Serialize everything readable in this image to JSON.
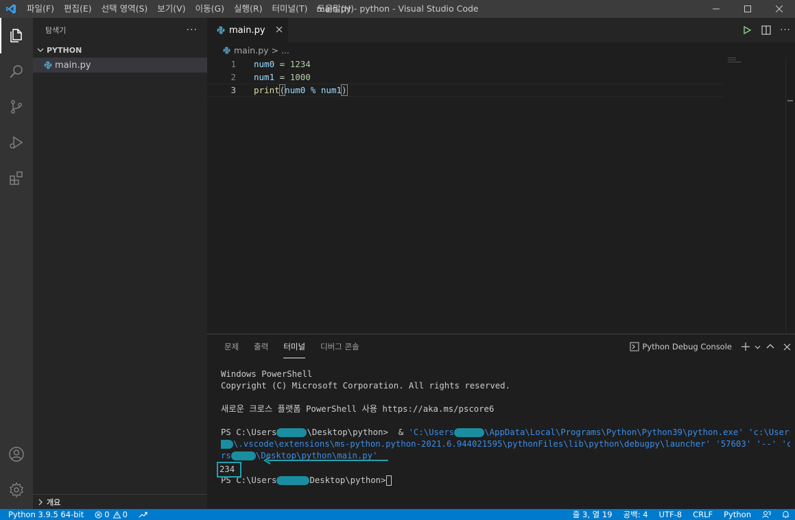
{
  "app": {
    "window_title": "main.py - python - Visual Studio Code",
    "logo_icon": "vscode-logo-icon"
  },
  "menu": [
    {
      "label": "파일(F)"
    },
    {
      "label": "편집(E)"
    },
    {
      "label": "선택 영역(S)"
    },
    {
      "label": "보기(V)"
    },
    {
      "label": "이동(G)"
    },
    {
      "label": "실행(R)"
    },
    {
      "label": "터미널(T)"
    },
    {
      "label": "도움말(H)"
    }
  ],
  "sidebar": {
    "title": "탐색기",
    "more": "···",
    "folder": "PYTHON",
    "file": "main.py",
    "outline": "개요"
  },
  "editor": {
    "tab_label": "main.py",
    "breadcrumb": "main.py > ...",
    "lines": [
      {
        "num": "1",
        "var": "num0",
        "op": " = ",
        "val": "1234"
      },
      {
        "num": "2",
        "var": "num1",
        "op": " = ",
        "val": "1000"
      },
      {
        "num": "3",
        "fn": "print",
        "open": "(",
        "args": "num0 % num1",
        "close": ")"
      }
    ]
  },
  "panel": {
    "tabs": [
      "문제",
      "출력",
      "터미널",
      "디버그 콘솔"
    ],
    "active_tab": "터미널",
    "terminal_name": "Python Debug Console",
    "terminal": {
      "line1": "Windows PowerShell",
      "line2": "Copyright (C) Microsoft Corporation. All rights reserved.",
      "line3": "새로운 크로스 플랫폼 PowerShell 사용 https://aka.ms/pscore6",
      "cmd_prompt_a": "PS C:\\Users",
      "cmd_prompt_b": "\\Desktop\\python>  & ",
      "cmd_str1_a": "'C:\\Users",
      "cmd_str1_b": "\\AppData\\Local\\Programs\\Python\\Python39\\python.exe'",
      "cmd_str2_a": " 'c:\\Users\\",
      "cmd_wrap1": "\\.vscode\\extensions\\ms-python.python-2021.6.944021595\\pythonFiles\\lib\\python\\debugpy\\launcher' '57603' '--' 'c:\\Use",
      "cmd_wrap2_a": "rs",
      "cmd_wrap2_b": "\\Desktop\\python\\main.py'",
      "result": "234",
      "final_prompt_a": "PS C:\\Users",
      "final_prompt_b": "Desktop\\python>"
    }
  },
  "statusbar": {
    "interpreter": "Python 3.9.5 64-bit",
    "errors": "0",
    "warnings": "0",
    "position": "줄 3, 열 19",
    "spaces": "공백: 4",
    "encoding": "UTF-8",
    "eol": "CRLF",
    "language": "Python"
  },
  "colors": {
    "accent": "#007acc",
    "annotation": "#1fa3b3"
  }
}
